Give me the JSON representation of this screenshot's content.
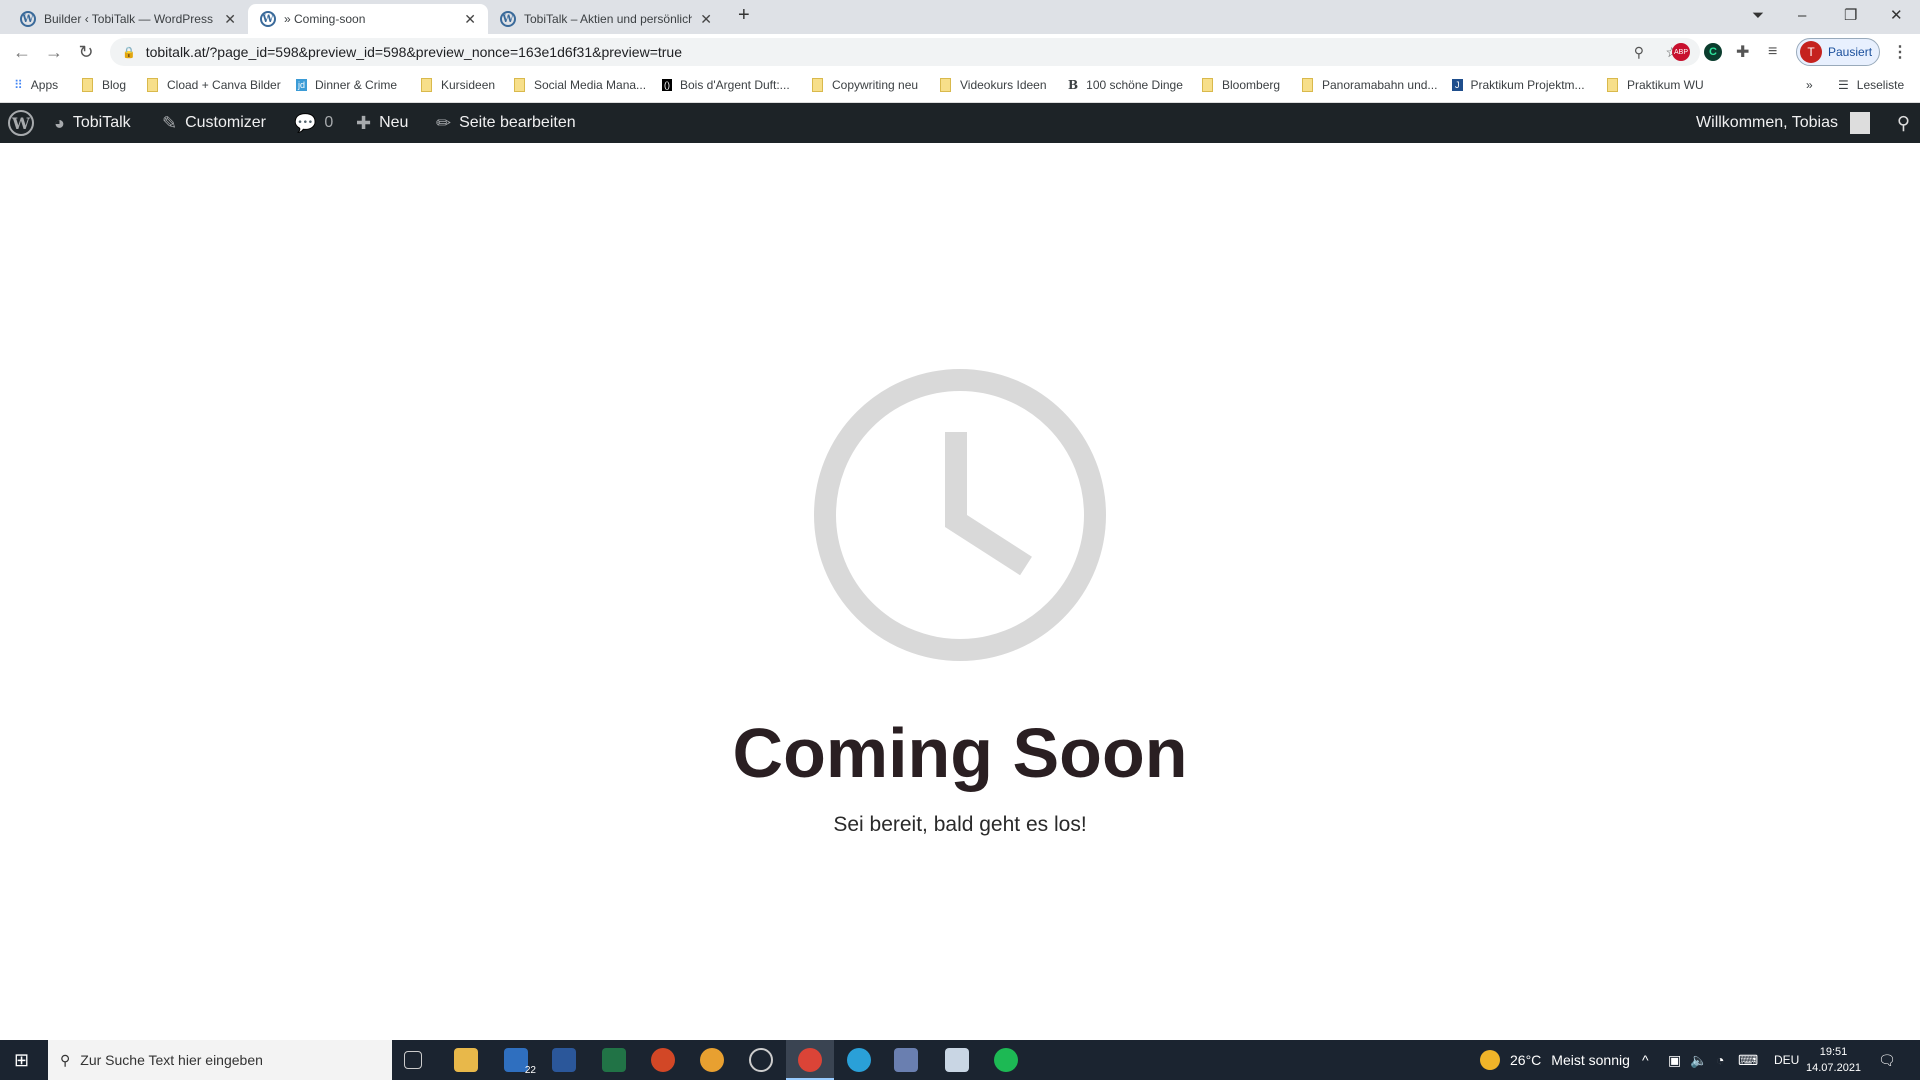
{
  "browser": {
    "tabs": [
      {
        "title": "Builder ‹ TobiTalk — WordPress",
        "active": false
      },
      {
        "title": "» Coming-soon",
        "active": true
      },
      {
        "title": "TobiTalk – Aktien und persönliche",
        "active": false
      }
    ],
    "url": "tobitalk.at/?page_id=598&preview_id=598&preview_nonce=163e1d6f31&preview=true",
    "profile_initial": "T",
    "profile_label": "Pausiert",
    "bookmarks": [
      "Apps",
      "Blog",
      "Cload + Canva Bilder",
      "Dinner & Crime",
      "Kursideen",
      "Social Media Mana...",
      "Bois d'Argent Duft:...",
      "Copywriting neu",
      "Videokurs Ideen",
      "100 schöne Dinge",
      "Bloomberg",
      "Panoramabahn und...",
      "Praktikum Projektm...",
      "Praktikum WU"
    ],
    "reading_list": "Leseliste"
  },
  "adminbar": {
    "site": "TobiTalk",
    "customizer": "Customizer",
    "comments": "0",
    "new": "Neu",
    "edit": "Seite bearbeiten",
    "welcome": "Willkommen, Tobias"
  },
  "page": {
    "title": "Coming Soon",
    "subtitle": "Sei bereit, bald geht es los!",
    "clock_color": "#d9d9d9"
  },
  "taskbar": {
    "search_placeholder": "Zur Suche Text hier eingeben",
    "mail_badge": "22",
    "weather": "26°C",
    "weather_text": "Meist sonnig",
    "lang": "DEU",
    "time": "19:51",
    "date": "14.07.2021"
  }
}
